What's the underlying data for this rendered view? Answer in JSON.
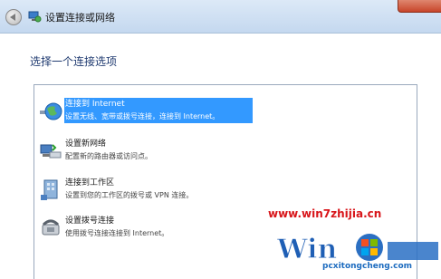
{
  "window": {
    "title": "设置连接或网络"
  },
  "heading": "选择一个连接选项",
  "options": [
    {
      "title": "连接到 Internet",
      "desc": "设置无线、宽带或拨号连接，连接到 Internet。",
      "icon": "globe-icon",
      "selected": true
    },
    {
      "title": "设置新网络",
      "desc": "配置新的路由器或访问点。",
      "icon": "router-icon",
      "selected": false
    },
    {
      "title": "连接到工作区",
      "desc": "设置到您的工作区的拨号或 VPN 连接。",
      "icon": "workplace-icon",
      "selected": false
    },
    {
      "title": "设置拨号连接",
      "desc": "使用拨号连接连接到 Internet。",
      "icon": "phone-icon",
      "selected": false
    }
  ],
  "watermark": {
    "site": "www.win7zhijia.cn",
    "sub": "pcxitongcheng.com"
  },
  "colors": {
    "selection": "#3399ff",
    "heading": "#1f3a70",
    "watermark": "#d8151a"
  }
}
